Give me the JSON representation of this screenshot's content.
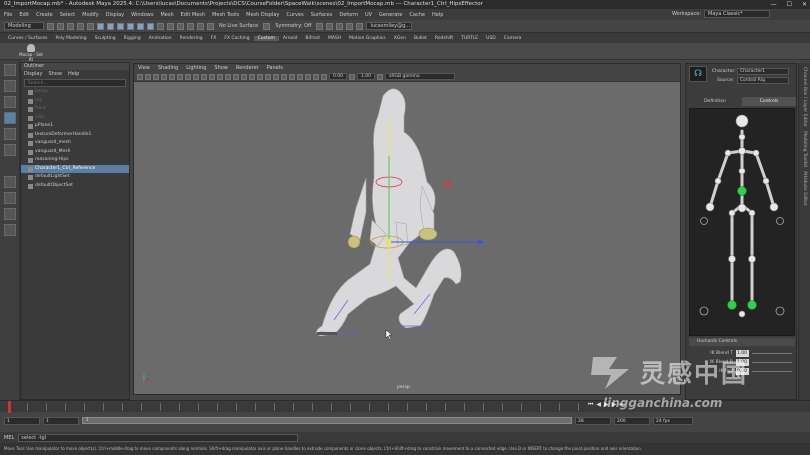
{
  "window": {
    "title": "02_ImportMocap.mb* - Autodesk Maya 2025.4: C:\\Users\\lucas\\Documents\\Projects\\DCS\\CourseFolder\\SpaceWalk\\scenes\\02_ImportMocap.mb  ---  Character1_Ctrl_HipsEffector",
    "controls": [
      "—",
      "☐",
      "✕"
    ]
  },
  "menubar": [
    "File",
    "Edit",
    "Create",
    "Select",
    "Modify",
    "Display",
    "Windows",
    "Mesh",
    "Edit Mesh",
    "Mesh Tools",
    "Mesh Display",
    "Curves",
    "Surfaces",
    "Deform",
    "UV",
    "Generate",
    "Cache",
    "Help"
  ],
  "workspace": {
    "label": "Workspace:",
    "value": "Maya Classic*"
  },
  "statusline": {
    "menuset": "Modeling",
    "live_surface": "No Live Surface",
    "symmetry": "Symmetry: Off",
    "user": "lucasmiley@g..."
  },
  "shelf_tabs": [
    "Curves / Surfaces",
    "Poly Modeling",
    "Sculpting",
    "Rigging",
    "Animation",
    "Rendering",
    "FX",
    "FX Caching",
    "Custom",
    "Arnold",
    "Bifrost",
    "MASH",
    "Motion Graphics",
    "XGen",
    "Bullet",
    "Redshift",
    "TURTLE",
    "USD",
    "Camera"
  ],
  "shelf_active": "Custom",
  "shelf_icon_label": "Mocap - Set Kt",
  "outliner": {
    "title": "Outliner",
    "menu": [
      "Display",
      "Show",
      "Help"
    ],
    "search_placeholder": "Search...",
    "items": [
      {
        "label": "persp",
        "dim": true
      },
      {
        "label": "top",
        "dim": true
      },
      {
        "label": "front",
        "dim": true
      },
      {
        "label": "side",
        "dim": true
      },
      {
        "label": "pPlane1",
        "dim": false
      },
      {
        "label": "textureDeformerHandle1",
        "dim": false
      },
      {
        "label": "vanguard_mesh",
        "dim": false
      },
      {
        "label": "vanguard_Mesh",
        "dim": false
      },
      {
        "label": "reasoning:Hips",
        "dim": false
      },
      {
        "label": "Character1_Ctrl_Reference",
        "dim": false
      },
      {
        "label": "defaultLightSet",
        "dim": false
      },
      {
        "label": "defaultObjectSet",
        "dim": false
      }
    ],
    "selected_index": 9
  },
  "viewport": {
    "menu": [
      "View",
      "Shading",
      "Lighting",
      "Show",
      "Renderer",
      "Panels"
    ],
    "exposure": "0.00",
    "gamma": "1.00",
    "colorspace": "sRGB gamma",
    "camera": "persp"
  },
  "hik": {
    "character_label": "Character:",
    "character_value": "Character1",
    "source_label": "Source:",
    "source_value": "Control Rig",
    "tabs": [
      "Definition",
      "Controls"
    ],
    "active_tab": "Controls",
    "section": "Humanlk Controls",
    "sliders": [
      {
        "label": "IK Blend T",
        "value": "1.00"
      },
      {
        "label": "IK Blend R",
        "value": "1.00"
      },
      {
        "label": "IK Pull",
        "value": "0.00"
      }
    ],
    "accent": "#2fd14a"
  },
  "right_strip": [
    "Channel Box / Layer Editor",
    "Modeling Toolkit",
    "Attribute Editor"
  ],
  "timeline": {
    "start": "1",
    "start2": "1",
    "current": "1",
    "end": "28",
    "end2": "28",
    "end3": "200",
    "fps": "24 fps",
    "range_label": "1"
  },
  "cmdline": {
    "label": "MEL",
    "value": "select -tgl"
  },
  "helpline": "Move Tool: Use manipulator to move object(s). Ctrl+middle-drag to move components along normals. Shift+drag manipulator axis or plane handles to extrude components or clone objects. Ctrl+Shift+drag to constrain movement to a connected edge. Use D or INSERT to change the pivot position and axis orientation.",
  "watermark": {
    "text": "灵感中国",
    "sub": "lingganchina.com"
  }
}
